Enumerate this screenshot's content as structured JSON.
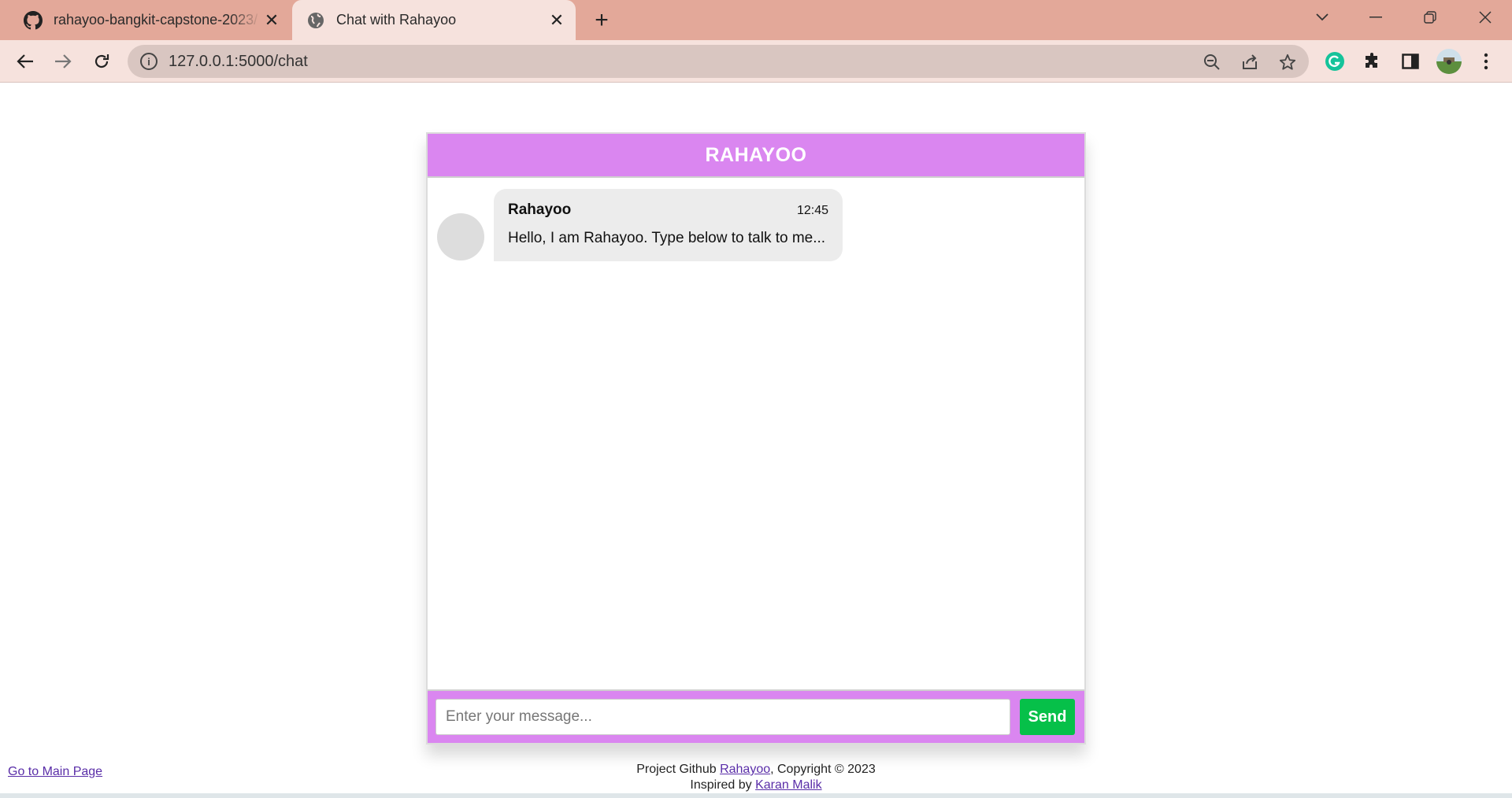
{
  "browser": {
    "tabs": [
      {
        "title": "rahayoo-bangkit-capstone-2023/",
        "icon": "github-icon",
        "active": false
      },
      {
        "title": "Chat with Rahayoo",
        "icon": "globe-icon",
        "active": true
      }
    ],
    "new_tab_label": "+",
    "url": "127.0.0.1:5000/chat"
  },
  "chat": {
    "header_title": "RAHAYOO",
    "messages": [
      {
        "sender": "Rahayoo",
        "time": "12:45",
        "text": "Hello, I am Rahayoo. Type below to talk to me..."
      }
    ],
    "input_placeholder": "Enter your message...",
    "send_label": "Send"
  },
  "page": {
    "main_link": "Go to Main Page",
    "footer": {
      "line1_prefix": "Project Github ",
      "line1_link": "Rahayoo",
      "line1_suffix": ", Copyright © 2023",
      "line2_prefix": "Inspired by ",
      "line2_link": "Karan Malik"
    }
  },
  "colors": {
    "tab_strip": "#e3a899",
    "toolbar": "#f6e2dd",
    "header": "#da86f0",
    "send_button": "#06c049",
    "bubble": "#ececec"
  }
}
